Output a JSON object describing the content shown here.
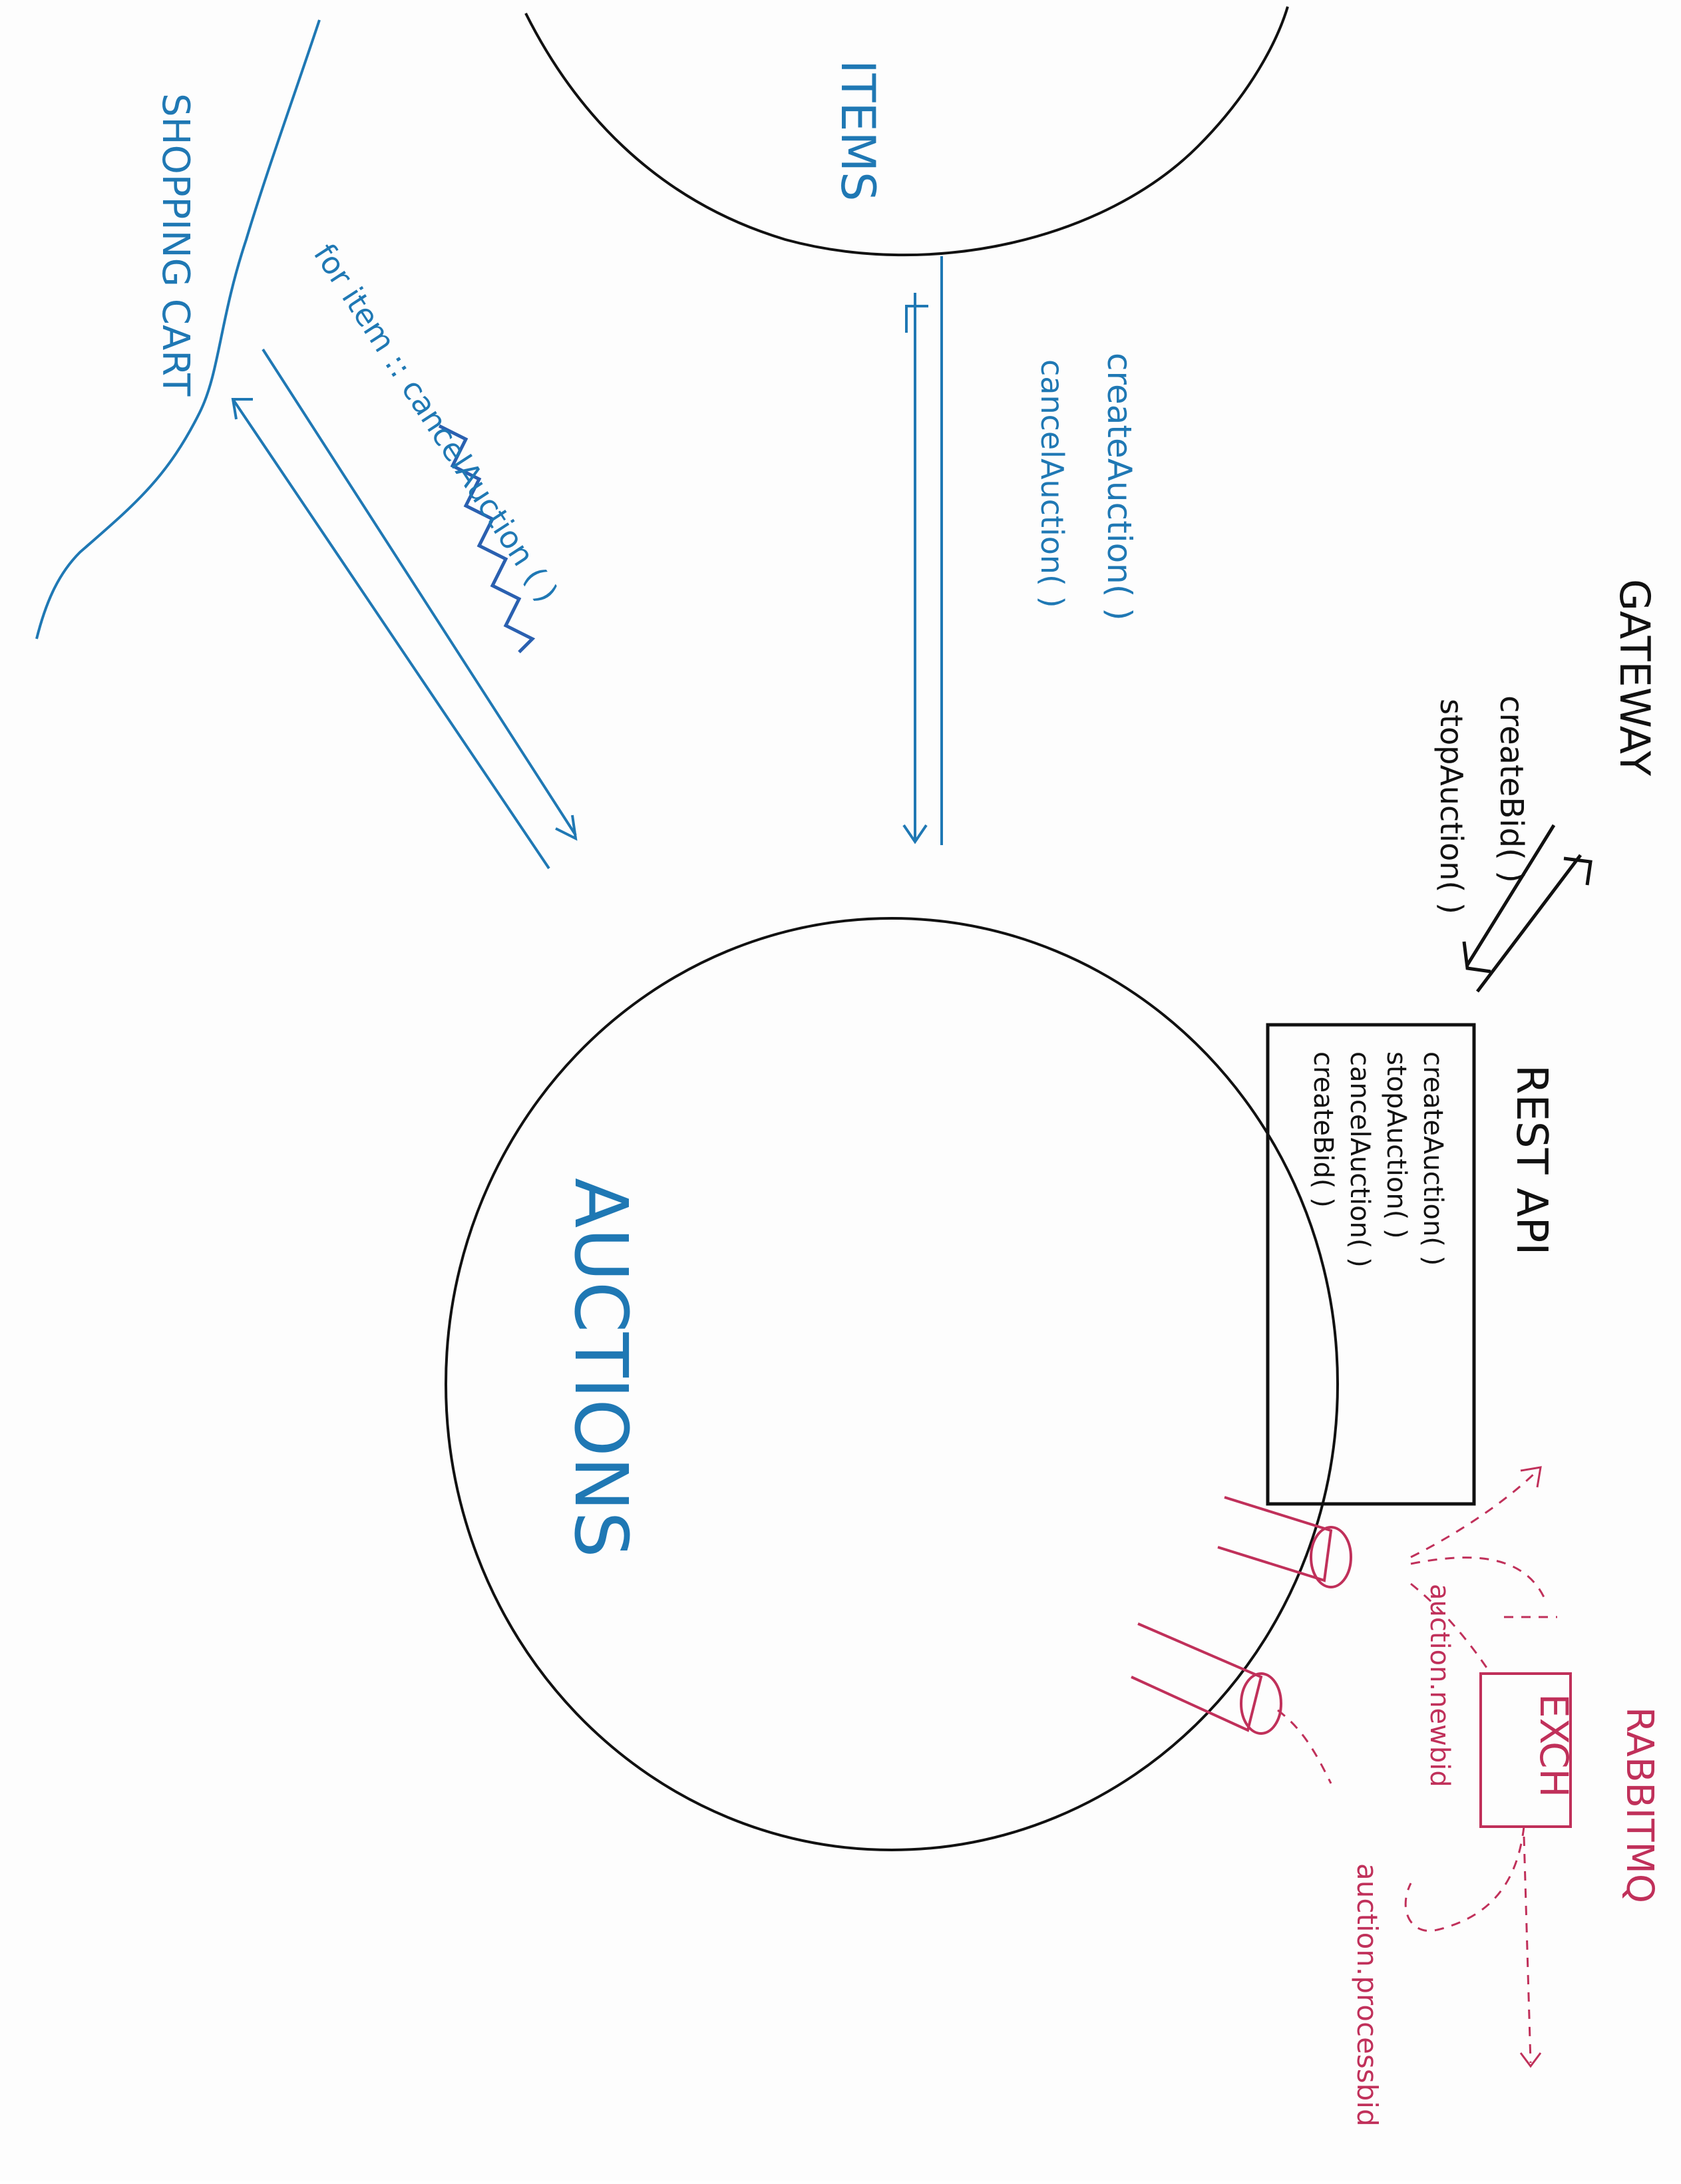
{
  "labels": {
    "items": "ITEMS",
    "shopping_cart": "SHOPPING CART",
    "gateway": "GATEWAY",
    "auctions": "AUCTIONS",
    "rest_api": "REST API",
    "rabbitmq": "RABBITMQ",
    "exch": "EXCH"
  },
  "flows": {
    "items_to_auctions": [
      "createAuction( )",
      "cancelAuction( )"
    ],
    "cart_to_auctions": [
      "for item :: cancelAuction ( )"
    ],
    "gateway_to_auctions": [
      "createBid( )",
      "stopAuction( )"
    ]
  },
  "rest_api_methods": [
    "createAuction( )",
    "stopAuction( )",
    "cancelAuction( )",
    "createBid( )"
  ],
  "queues": {
    "new_bid": "auction.newbid",
    "process_bid": "auction.processbid"
  },
  "colors": {
    "blue": "#1f78b4",
    "black": "#111111",
    "red": "#c0305a"
  }
}
